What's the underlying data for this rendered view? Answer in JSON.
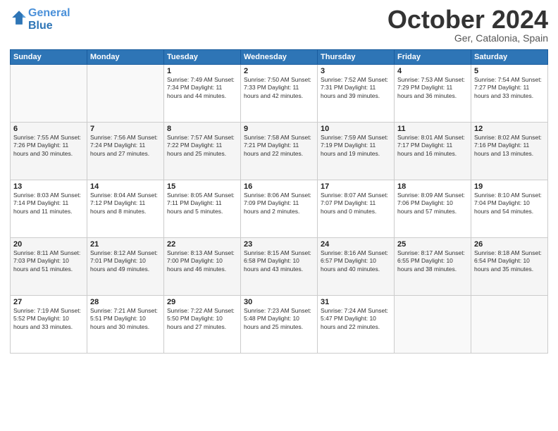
{
  "header": {
    "logo_line1": "General",
    "logo_line2": "Blue",
    "month": "October 2024",
    "location": "Ger, Catalonia, Spain"
  },
  "weekdays": [
    "Sunday",
    "Monday",
    "Tuesday",
    "Wednesday",
    "Thursday",
    "Friday",
    "Saturday"
  ],
  "weeks": [
    [
      {
        "day": "",
        "info": ""
      },
      {
        "day": "",
        "info": ""
      },
      {
        "day": "1",
        "info": "Sunrise: 7:49 AM\nSunset: 7:34 PM\nDaylight: 11 hours and 44 minutes."
      },
      {
        "day": "2",
        "info": "Sunrise: 7:50 AM\nSunset: 7:33 PM\nDaylight: 11 hours and 42 minutes."
      },
      {
        "day": "3",
        "info": "Sunrise: 7:52 AM\nSunset: 7:31 PM\nDaylight: 11 hours and 39 minutes."
      },
      {
        "day": "4",
        "info": "Sunrise: 7:53 AM\nSunset: 7:29 PM\nDaylight: 11 hours and 36 minutes."
      },
      {
        "day": "5",
        "info": "Sunrise: 7:54 AM\nSunset: 7:27 PM\nDaylight: 11 hours and 33 minutes."
      }
    ],
    [
      {
        "day": "6",
        "info": "Sunrise: 7:55 AM\nSunset: 7:26 PM\nDaylight: 11 hours and 30 minutes."
      },
      {
        "day": "7",
        "info": "Sunrise: 7:56 AM\nSunset: 7:24 PM\nDaylight: 11 hours and 27 minutes."
      },
      {
        "day": "8",
        "info": "Sunrise: 7:57 AM\nSunset: 7:22 PM\nDaylight: 11 hours and 25 minutes."
      },
      {
        "day": "9",
        "info": "Sunrise: 7:58 AM\nSunset: 7:21 PM\nDaylight: 11 hours and 22 minutes."
      },
      {
        "day": "10",
        "info": "Sunrise: 7:59 AM\nSunset: 7:19 PM\nDaylight: 11 hours and 19 minutes."
      },
      {
        "day": "11",
        "info": "Sunrise: 8:01 AM\nSunset: 7:17 PM\nDaylight: 11 hours and 16 minutes."
      },
      {
        "day": "12",
        "info": "Sunrise: 8:02 AM\nSunset: 7:16 PM\nDaylight: 11 hours and 13 minutes."
      }
    ],
    [
      {
        "day": "13",
        "info": "Sunrise: 8:03 AM\nSunset: 7:14 PM\nDaylight: 11 hours and 11 minutes."
      },
      {
        "day": "14",
        "info": "Sunrise: 8:04 AM\nSunset: 7:12 PM\nDaylight: 11 hours and 8 minutes."
      },
      {
        "day": "15",
        "info": "Sunrise: 8:05 AM\nSunset: 7:11 PM\nDaylight: 11 hours and 5 minutes."
      },
      {
        "day": "16",
        "info": "Sunrise: 8:06 AM\nSunset: 7:09 PM\nDaylight: 11 hours and 2 minutes."
      },
      {
        "day": "17",
        "info": "Sunrise: 8:07 AM\nSunset: 7:07 PM\nDaylight: 11 hours and 0 minutes."
      },
      {
        "day": "18",
        "info": "Sunrise: 8:09 AM\nSunset: 7:06 PM\nDaylight: 10 hours and 57 minutes."
      },
      {
        "day": "19",
        "info": "Sunrise: 8:10 AM\nSunset: 7:04 PM\nDaylight: 10 hours and 54 minutes."
      }
    ],
    [
      {
        "day": "20",
        "info": "Sunrise: 8:11 AM\nSunset: 7:03 PM\nDaylight: 10 hours and 51 minutes."
      },
      {
        "day": "21",
        "info": "Sunrise: 8:12 AM\nSunset: 7:01 PM\nDaylight: 10 hours and 49 minutes."
      },
      {
        "day": "22",
        "info": "Sunrise: 8:13 AM\nSunset: 7:00 PM\nDaylight: 10 hours and 46 minutes."
      },
      {
        "day": "23",
        "info": "Sunrise: 8:15 AM\nSunset: 6:58 PM\nDaylight: 10 hours and 43 minutes."
      },
      {
        "day": "24",
        "info": "Sunrise: 8:16 AM\nSunset: 6:57 PM\nDaylight: 10 hours and 40 minutes."
      },
      {
        "day": "25",
        "info": "Sunrise: 8:17 AM\nSunset: 6:55 PM\nDaylight: 10 hours and 38 minutes."
      },
      {
        "day": "26",
        "info": "Sunrise: 8:18 AM\nSunset: 6:54 PM\nDaylight: 10 hours and 35 minutes."
      }
    ],
    [
      {
        "day": "27",
        "info": "Sunrise: 7:19 AM\nSunset: 5:52 PM\nDaylight: 10 hours and 33 minutes."
      },
      {
        "day": "28",
        "info": "Sunrise: 7:21 AM\nSunset: 5:51 PM\nDaylight: 10 hours and 30 minutes."
      },
      {
        "day": "29",
        "info": "Sunrise: 7:22 AM\nSunset: 5:50 PM\nDaylight: 10 hours and 27 minutes."
      },
      {
        "day": "30",
        "info": "Sunrise: 7:23 AM\nSunset: 5:48 PM\nDaylight: 10 hours and 25 minutes."
      },
      {
        "day": "31",
        "info": "Sunrise: 7:24 AM\nSunset: 5:47 PM\nDaylight: 10 hours and 22 minutes."
      },
      {
        "day": "",
        "info": ""
      },
      {
        "day": "",
        "info": ""
      }
    ]
  ]
}
